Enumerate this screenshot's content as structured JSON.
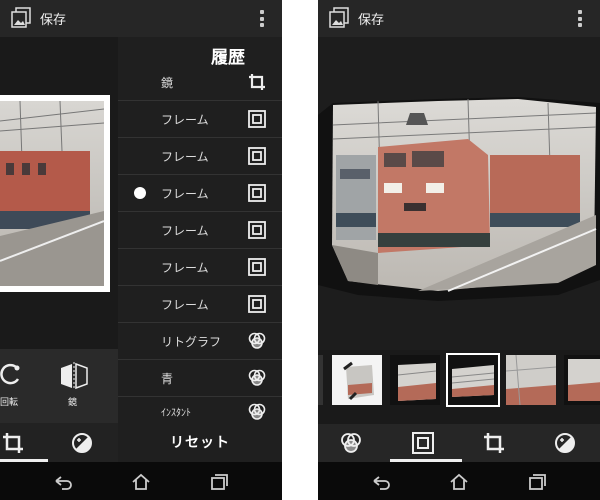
{
  "left_screen": {
    "topbar": {
      "save_label": "保存"
    },
    "tools": [
      {
        "label": "回転",
        "icon": "rotate-icon"
      },
      {
        "label": "鏡",
        "icon": "mirror-icon"
      }
    ],
    "history": {
      "title": "履歴",
      "items": [
        {
          "label": "鏡",
          "icon": "crop-icon",
          "selected": false
        },
        {
          "label": "フレーム",
          "icon": "frame-icon",
          "selected": false
        },
        {
          "label": "フレーム",
          "icon": "frame-icon",
          "selected": false
        },
        {
          "label": "フレーム",
          "icon": "frame-icon",
          "selected": true
        },
        {
          "label": "フレーム",
          "icon": "frame-icon",
          "selected": false
        },
        {
          "label": "フレーム",
          "icon": "frame-icon",
          "selected": false
        },
        {
          "label": "フレーム",
          "icon": "frame-icon",
          "selected": false
        },
        {
          "label": "リトグラフ",
          "icon": "filter-icon",
          "selected": false
        },
        {
          "label": "青",
          "icon": "filter-icon",
          "selected": false
        },
        {
          "label": "ｲﾝｽﾀﾝﾄ",
          "icon": "filter-icon",
          "selected": false
        }
      ],
      "reset_label": "リセット"
    },
    "bottom_tabs": [
      "crop-icon",
      "adjust-icon"
    ]
  },
  "right_screen": {
    "topbar": {
      "save_label": "保存"
    },
    "bottom_tabs": [
      "filter-icon",
      "frame-icon",
      "crop-icon",
      "adjust-icon"
    ],
    "active_tab": "frame-icon"
  },
  "colors": {
    "bar": "#262626",
    "background": "#1a1a1a",
    "accent": "#ffffff"
  }
}
